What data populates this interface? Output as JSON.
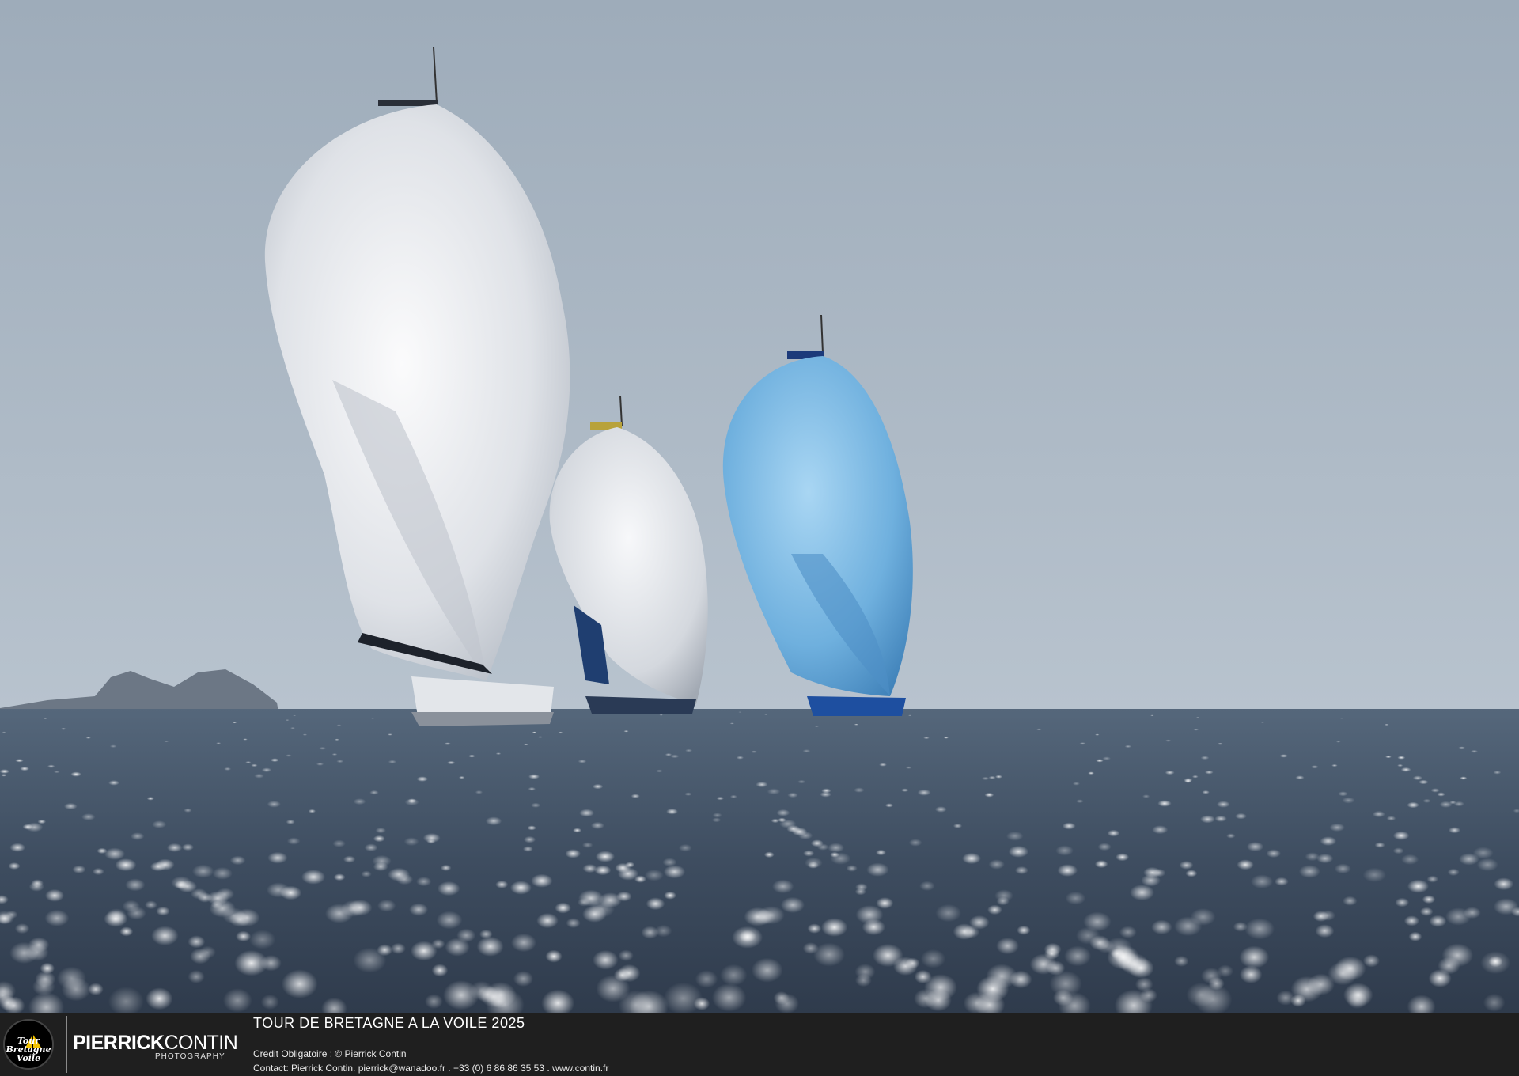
{
  "footer": {
    "badge_line1": "Tour",
    "badge_line2": "Bretagne",
    "badge_line3": "Voile",
    "brand_bold": "PIERRICK",
    "brand_light": "CONTIN",
    "brand_sub": "PHOTOGRAPHY",
    "event_title": "TOUR DE BRETAGNE A LA VOILE 2025",
    "credit": "Credit Obligatoire : © Pierrick Contin",
    "contact": "Contact: Pierrick Contin. pierrick@wanadoo.fr . +33 (0) 6 86 86 35 53 . www.contin.fr"
  },
  "colors": {
    "sky": "#a6b4c2",
    "sea": "#3f4f62",
    "spinnaker_white": "#eef0f3",
    "spinnaker_blue": "#74b6e2",
    "footer_bg": "#1f1f1f",
    "badge_accent": "#f2c200"
  }
}
